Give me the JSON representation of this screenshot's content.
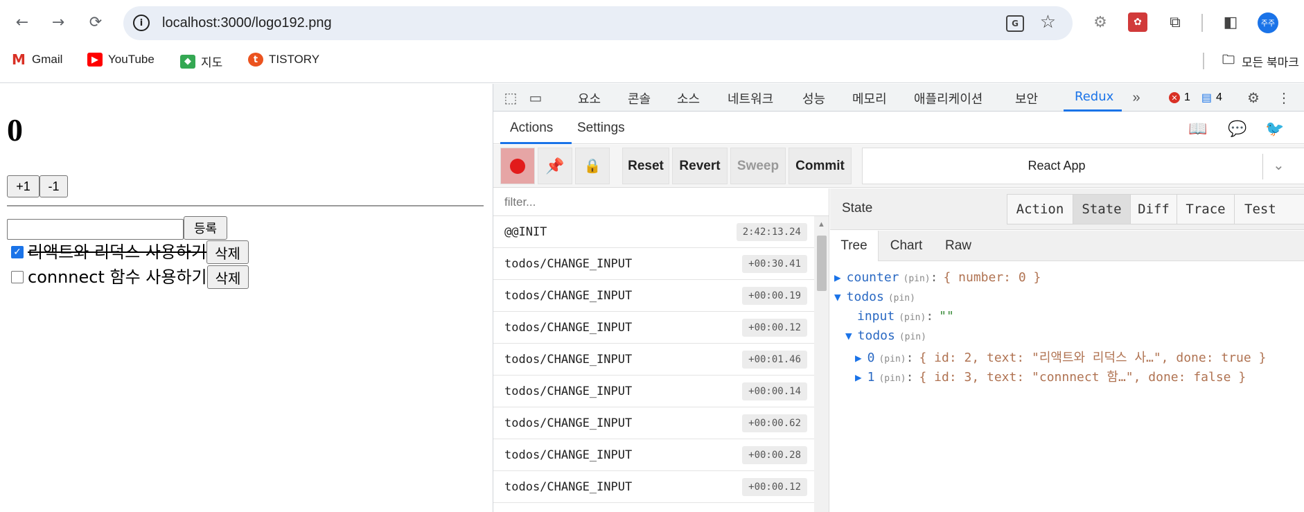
{
  "browser": {
    "url": "localhost:3000/logo192.png",
    "profile_label": "주주",
    "bookmarks": [
      {
        "label": "Gmail",
        "icon": "gmail-icon"
      },
      {
        "label": "YouTube",
        "icon": "youtube-icon"
      },
      {
        "label": "지도",
        "icon": "maps-icon"
      },
      {
        "label": "TISTORY",
        "icon": "tistory-icon"
      }
    ],
    "bookmarks_folder": "모든 북마크"
  },
  "page": {
    "counter": "0",
    "inc_label": "+1",
    "dec_label": "-1",
    "input_value": "",
    "add_label": "등록",
    "todos": [
      {
        "text": "리액트와 리덕스 사용하기",
        "done": true,
        "delete_label": "삭제"
      },
      {
        "text": "connnect 함수 사용하기",
        "done": false,
        "delete_label": "삭제"
      }
    ]
  },
  "devtools": {
    "tabs": [
      "요소",
      "콘솔",
      "소스",
      "네트워크",
      "성능",
      "메모리",
      "애플리케이션",
      "보안",
      "Redux"
    ],
    "active_tab": "Redux",
    "errors_count": "1",
    "messages_count": "4",
    "accent": "#1a73e8"
  },
  "redux": {
    "tabs": [
      "Actions",
      "Settings"
    ],
    "toolbar": {
      "reset": "Reset",
      "revert": "Revert",
      "sweep": "Sweep",
      "commit": "Commit"
    },
    "instance": "React App",
    "filter_placeholder": "filter...",
    "actions": [
      {
        "name": "@@INIT",
        "time": "2:42:13.24"
      },
      {
        "name": "todos/CHANGE_INPUT",
        "time": "+00:30.41"
      },
      {
        "name": "todos/CHANGE_INPUT",
        "time": "+00:00.19"
      },
      {
        "name": "todos/CHANGE_INPUT",
        "time": "+00:00.12"
      },
      {
        "name": "todos/CHANGE_INPUT",
        "time": "+00:01.46"
      },
      {
        "name": "todos/CHANGE_INPUT",
        "time": "+00:00.14"
      },
      {
        "name": "todos/CHANGE_INPUT",
        "time": "+00:00.62"
      },
      {
        "name": "todos/CHANGE_INPUT",
        "time": "+00:00.28"
      },
      {
        "name": "todos/CHANGE_INPUT",
        "time": "+00:00.12"
      }
    ],
    "state_title": "State",
    "monitor_tabs": [
      "Action",
      "State",
      "Diff",
      "Trace",
      "Test"
    ],
    "sub_tabs": [
      "Tree",
      "Chart",
      "Raw"
    ],
    "tree": {
      "counter": {
        "key": "counter",
        "pin": "(pin)",
        "value": "{ number: 0 }"
      },
      "todos": {
        "key": "todos",
        "pin": "(pin)"
      },
      "input": {
        "key": "input",
        "pin": "(pin)",
        "value": "\"\""
      },
      "todos_list": {
        "key": "todos",
        "pin": "(pin)"
      },
      "item0": {
        "key": "0",
        "pin": "(pin)",
        "value": "{ id: 2, text: \"리액트와 리덕스 사…\", done: true }"
      },
      "item1": {
        "key": "1",
        "pin": "(pin)",
        "value": "{ id: 3, text: \"connnect 함…\", done: false }"
      }
    }
  }
}
